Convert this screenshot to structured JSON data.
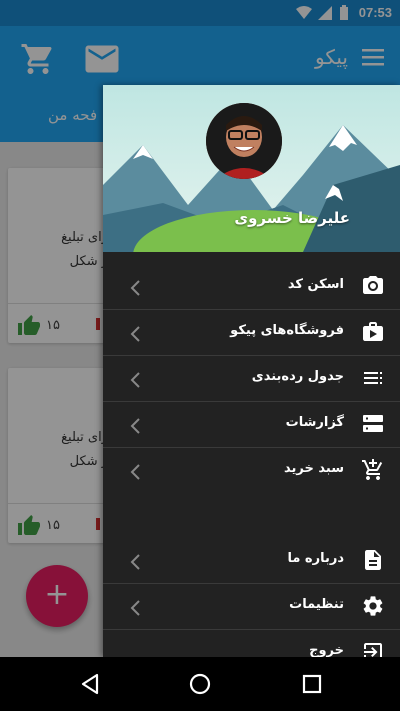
{
  "statusbar": {
    "time": "07:53"
  },
  "appbar": {
    "title": "پیکو"
  },
  "tab": {
    "label": "فحه من"
  },
  "cards": [
    {
      "line1": "رای تبلیغ",
      "line2": "ر شکل",
      "count": "۱۵"
    },
    {
      "line1": "رای تبلیغ",
      "line2": "ر شکل",
      "count": "۱۵"
    }
  ],
  "fab": {
    "label": "+"
  },
  "drawer": {
    "user_name": "علیرضا خسروی",
    "items": [
      {
        "label": "اسکن کد",
        "icon": "camera-icon"
      },
      {
        "label": "فروشگاه‌های پیکو",
        "icon": "shop-bag-icon"
      },
      {
        "label": "جدول رده‌بندی",
        "icon": "list-icon"
      },
      {
        "label": "گزارشات",
        "icon": "storage-icon"
      },
      {
        "label": "سبد خرید",
        "icon": "add-cart-icon"
      },
      {
        "label": "درباره ما",
        "icon": "document-icon"
      },
      {
        "label": "تنظیمات",
        "icon": "gear-icon"
      },
      {
        "label": "خروج",
        "icon": "exit-icon"
      }
    ]
  },
  "colors": {
    "primary": "#21a8f4",
    "status": "#1a8bd0",
    "drawer_bg": "#222222",
    "fab": "#e91e63",
    "like": "#43a047"
  }
}
